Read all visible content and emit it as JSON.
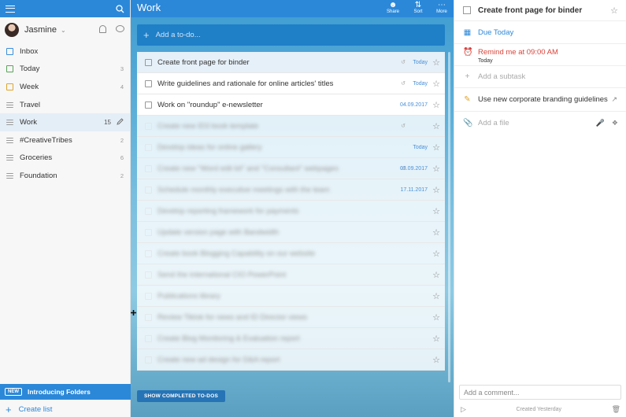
{
  "sidebar": {
    "user_name": "Jasmine",
    "items": [
      {
        "label": "Inbox",
        "count": "",
        "icon": "inbox-icon"
      },
      {
        "label": "Today",
        "count": "3",
        "icon": "today-icon"
      },
      {
        "label": "Week",
        "count": "4",
        "icon": "week-icon"
      },
      {
        "label": "Travel",
        "count": "",
        "icon": "list-icon"
      },
      {
        "label": "Work",
        "count": "15",
        "icon": "list-icon"
      },
      {
        "label": "#CreativeTribes",
        "count": "2",
        "icon": "list-icon"
      },
      {
        "label": "Groceries",
        "count": "6",
        "icon": "list-icon"
      },
      {
        "label": "Foundation",
        "count": "2",
        "icon": "list-icon"
      }
    ],
    "new_badge": "NEW",
    "intro_label": "Introducing Folders",
    "create_list": "Create list"
  },
  "main": {
    "title": "Work",
    "actions": {
      "share": "Share",
      "sort": "Sort",
      "more": "More"
    },
    "add_placeholder": "Add a to-do...",
    "tasks": [
      {
        "title": "Create front page for binder",
        "due": "Today"
      },
      {
        "title": "Write guidelines and rationale for online articles' titles",
        "due": "Today"
      },
      {
        "title": "Work on \"roundup\" e-newsletter",
        "due": "04.09.2017"
      },
      {
        "title": "Create new ID3 book template",
        "due": ""
      },
      {
        "title": "Develop ideas for online gallery",
        "due": "Today"
      },
      {
        "title": "Create new \"Word edit kit\" and \"Consultant\" webpages",
        "due": "03.09.2017"
      },
      {
        "title": "Schedule monthly executive meetings with the team",
        "due": "17.11.2017"
      },
      {
        "title": "Develop reporting framework for payments",
        "due": ""
      },
      {
        "title": "Update version page with Bandwidth",
        "due": ""
      },
      {
        "title": "Create book Blogging Capability on our website",
        "due": ""
      },
      {
        "title": "Send the international CIO PowerPoint",
        "due": ""
      },
      {
        "title": "Publications library",
        "due": ""
      },
      {
        "title": "Review Tiktok for news and ID Director views",
        "due": ""
      },
      {
        "title": "Create Blog Monitoring & Evaluation report",
        "due": ""
      },
      {
        "title": "Create new ad design for D&A report",
        "due": ""
      }
    ],
    "show_completed": "SHOW COMPLETED TO-DOS"
  },
  "detail": {
    "title": "Create front page for binder",
    "due": "Due Today",
    "reminder": "Remind me at 09:00 AM",
    "reminder_sub": "Today",
    "add_subtask": "Add a subtask",
    "note": "Use new corporate branding guidelines",
    "add_file": "Add a file",
    "comment_placeholder": "Add a comment...",
    "created": "Created Yesterday"
  },
  "colors": {
    "accent": "#2b88d9",
    "reminder": "#d9453b"
  }
}
